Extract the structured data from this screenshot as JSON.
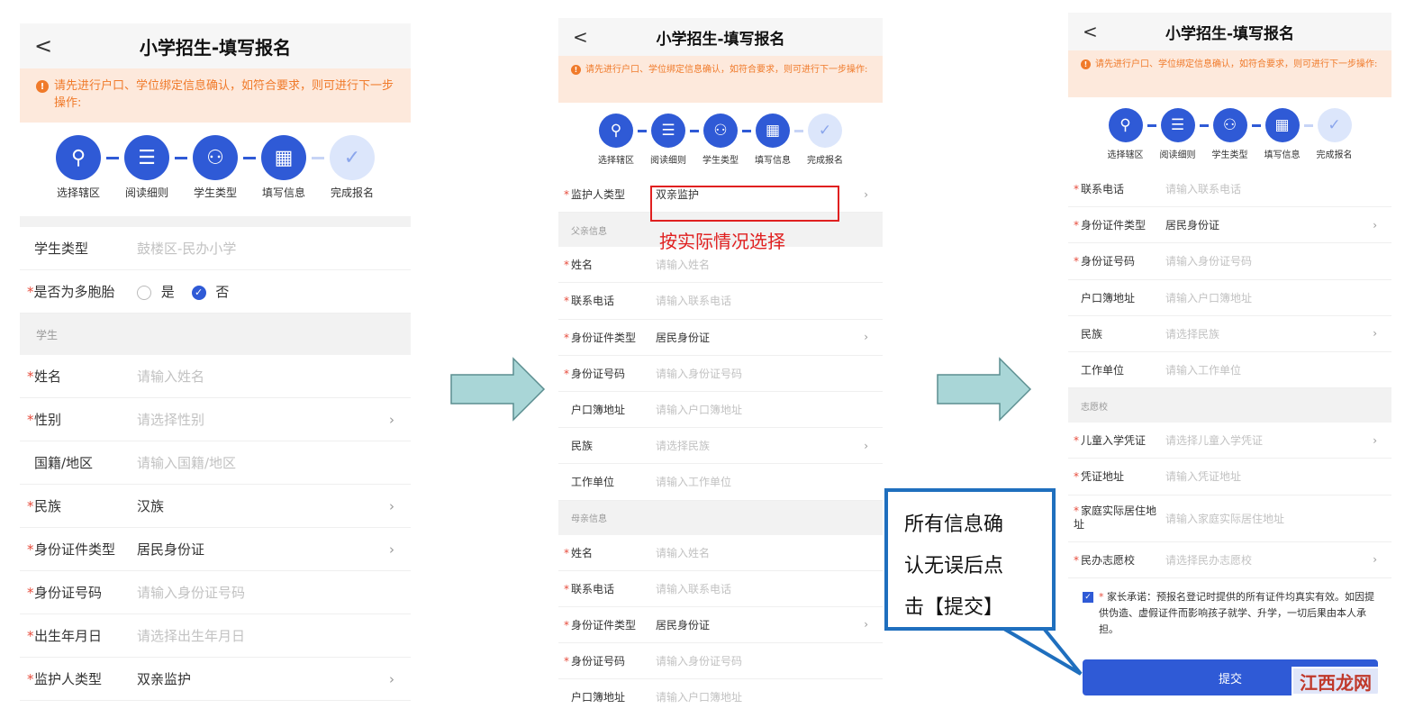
{
  "header": {
    "back": "<",
    "title": "小学招生-填写报名"
  },
  "notice": {
    "icon": "!",
    "text": "请先进行户口、学位绑定信息确认，如符合要求，则可进行下一步操作:"
  },
  "steps": [
    {
      "label": "选择辖区",
      "icon": "location-pin-icon",
      "glyph": "⚲",
      "done": false
    },
    {
      "label": "阅读细则",
      "icon": "document-icon",
      "glyph": "☰",
      "done": false
    },
    {
      "label": "学生类型",
      "icon": "person-icon",
      "glyph": "⚇",
      "done": false
    },
    {
      "label": "填写信息",
      "icon": "form-icon",
      "glyph": "▦",
      "done": false
    },
    {
      "label": "完成报名",
      "icon": "check-circle-icon",
      "glyph": "✓",
      "done": true
    }
  ],
  "panel1": {
    "rows_top": [
      {
        "label": "学生类型",
        "required": false,
        "value": "鼓楼区-民办小学",
        "placeholder": true,
        "chevron": false
      }
    ],
    "twins": {
      "label": "是否为多胞胎",
      "yes": "是",
      "no": "否"
    },
    "section_student": "学生",
    "rows": [
      {
        "label": "姓名",
        "required": true,
        "value": "请输入姓名",
        "placeholder": true,
        "chevron": false
      },
      {
        "label": "性别",
        "required": true,
        "value": "请选择性别",
        "placeholder": true,
        "chevron": true
      },
      {
        "label": "国籍/地区",
        "required": false,
        "value": "请输入国籍/地区",
        "placeholder": true,
        "chevron": false
      },
      {
        "label": "民族",
        "required": true,
        "value": "汉族",
        "placeholder": false,
        "chevron": true
      },
      {
        "label": "身份证件类型",
        "required": true,
        "value": "居民身份证",
        "placeholder": false,
        "chevron": true
      },
      {
        "label": "身份证号码",
        "required": true,
        "value": "请输入身份证号码",
        "placeholder": true,
        "chevron": false
      },
      {
        "label": "出生年月日",
        "required": true,
        "value": "请选择出生年月日",
        "placeholder": true,
        "chevron": false
      },
      {
        "label": "监护人类型",
        "required": true,
        "value": "双亲监护",
        "placeholder": false,
        "chevron": true
      }
    ]
  },
  "panel2": {
    "guardian": {
      "label": "监护人类型",
      "required": true,
      "value": "双亲监护",
      "placeholder": false,
      "chevron": true
    },
    "section_father": "父亲信息",
    "father_rows": [
      {
        "label": "姓名",
        "required": true,
        "value": "请输入姓名",
        "placeholder": true,
        "chevron": false
      },
      {
        "label": "联系电话",
        "required": true,
        "value": "请输入联系电话",
        "placeholder": true,
        "chevron": false
      },
      {
        "label": "身份证件类型",
        "required": true,
        "value": "居民身份证",
        "placeholder": false,
        "chevron": true
      },
      {
        "label": "身份证号码",
        "required": true,
        "value": "请输入身份证号码",
        "placeholder": true,
        "chevron": false
      },
      {
        "label": "户口簿地址",
        "required": false,
        "value": "请输入户口簿地址",
        "placeholder": true,
        "chevron": false
      },
      {
        "label": "民族",
        "required": false,
        "value": "请选择民族",
        "placeholder": true,
        "chevron": true
      },
      {
        "label": "工作单位",
        "required": false,
        "value": "请输入工作单位",
        "placeholder": true,
        "chevron": false
      }
    ],
    "section_mother": "母亲信息",
    "mother_rows": [
      {
        "label": "姓名",
        "required": true,
        "value": "请输入姓名",
        "placeholder": true,
        "chevron": false
      },
      {
        "label": "联系电话",
        "required": true,
        "value": "请输入联系电话",
        "placeholder": true,
        "chevron": false
      },
      {
        "label": "身份证件类型",
        "required": true,
        "value": "居民身份证",
        "placeholder": false,
        "chevron": true
      },
      {
        "label": "身份证号码",
        "required": true,
        "value": "请输入身份证号码",
        "placeholder": true,
        "chevron": false
      },
      {
        "label": "户口簿地址",
        "required": false,
        "value": "请输入户口簿地址",
        "placeholder": true,
        "chevron": false
      }
    ]
  },
  "panel3": {
    "rows": [
      {
        "label": "联系电话",
        "required": true,
        "value": "请输入联系电话",
        "placeholder": true,
        "chevron": false
      },
      {
        "label": "身份证件类型",
        "required": true,
        "value": "居民身份证",
        "placeholder": false,
        "chevron": true
      },
      {
        "label": "身份证号码",
        "required": true,
        "value": "请输入身份证号码",
        "placeholder": true,
        "chevron": false
      },
      {
        "label": "户口簿地址",
        "required": false,
        "value": "请输入户口簿地址",
        "placeholder": true,
        "chevron": false
      },
      {
        "label": "民族",
        "required": false,
        "value": "请选择民族",
        "placeholder": true,
        "chevron": true
      },
      {
        "label": "工作单位",
        "required": false,
        "value": "请输入工作单位",
        "placeholder": true,
        "chevron": false
      }
    ],
    "section_school": "志愿校",
    "school_rows": [
      {
        "label": "儿童入学凭证",
        "required": true,
        "value": "请选择儿童入学凭证",
        "placeholder": true,
        "chevron": true,
        "tall": false
      },
      {
        "label": "凭证地址",
        "required": true,
        "value": "请输入凭证地址",
        "placeholder": true,
        "chevron": false,
        "tall": false
      },
      {
        "label": "家庭实际居住地址",
        "required": true,
        "value": "请输入家庭实际居住地址",
        "placeholder": true,
        "chevron": false,
        "tall": true
      },
      {
        "label": "民办志愿校",
        "required": true,
        "value": "请选择民办志愿校",
        "placeholder": true,
        "chevron": true,
        "tall": false
      }
    ],
    "commitment_title": "家长承诺：",
    "commitment_text": "预报名登记时提供的所有证件均真实有效。如因提供伪造、虚假证件而影响孩子就学、升学，一切后果由本人承担。",
    "submit": "提交"
  },
  "annotations": {
    "red_hint": "按实际情况选择",
    "blue_note_lines": [
      "所有信息确",
      "认无误后点",
      "击【提交】"
    ],
    "watermark": "江西龙网"
  },
  "colors": {
    "primary": "#2f5ad6",
    "notice_bg": "#fde9dc",
    "notice_text": "#f07a2a",
    "arrow": "#a9d6d7",
    "highlight": "#e02020",
    "callout_border": "#1f6fbe"
  }
}
